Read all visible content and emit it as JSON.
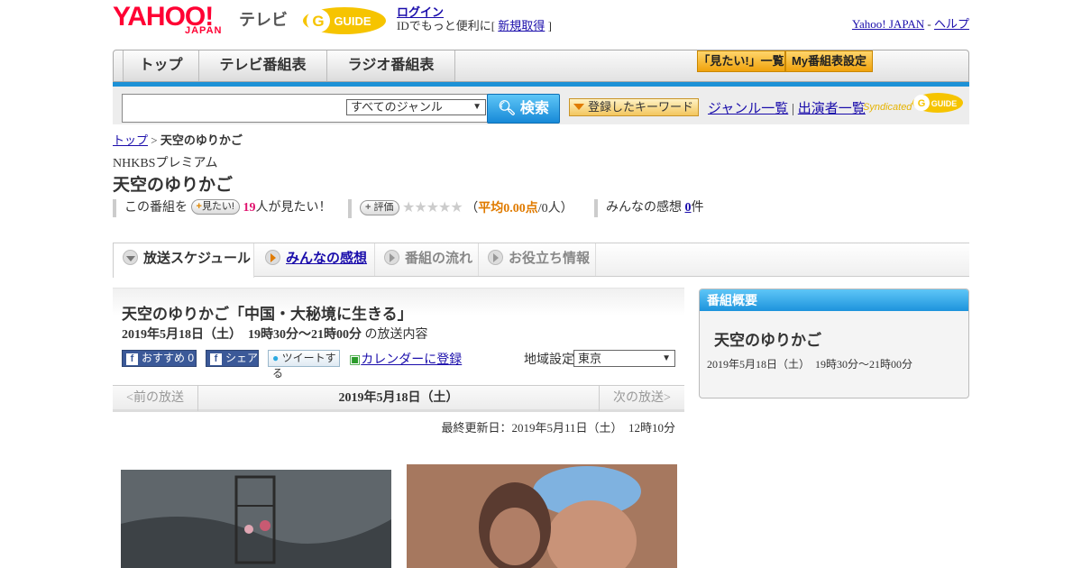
{
  "header": {
    "logo": "YAHOO!",
    "logo_sub": "JAPAN",
    "service": "テレビ",
    "gguide_logo": "GUIDE",
    "login_link": "ログイン",
    "login_text": "IDでもっと便利に[",
    "register_link": "新規取得",
    "login_close": "]",
    "yahoo_japan_link": "Yahoo! JAPAN",
    "sep": " - ",
    "help_link": "ヘルプ"
  },
  "nav": {
    "tabs": [
      "トップ",
      "テレビ番組表",
      "ラジオ番組表"
    ],
    "want_list": "「見たい!」一覧",
    "my_schedule": "My番組表設定"
  },
  "search": {
    "placeholder": "",
    "genre": "すべてのジャンル",
    "button": "検索",
    "keyword_button": "登録したキーワード",
    "genre_list": "ジャンル一覧",
    "divider": "|",
    "performer_list": "出演者一覧",
    "syndicated": "Syndicated"
  },
  "breadcrumb": {
    "top": "トップ",
    "sep": " > ",
    "current": "天空のゆりかご"
  },
  "program": {
    "channel": "NHKBSプレミアム",
    "title": "天空のゆりかご",
    "want_prefix": "この番組を",
    "want_button": "見たい!",
    "want_count": "19",
    "want_suffix": "人が見たい！",
    "rate_button": "評価",
    "stars": "★★★★★",
    "avg_open": "（",
    "avg_label": "平均0.00点",
    "avg_suffix": "/0人）",
    "impressions_prefix": "みんなの感想",
    "impressions_count": "0",
    "impressions_suffix": "件"
  },
  "tabs": [
    {
      "label": "放送スケジュール"
    },
    {
      "label": "みんなの感想"
    },
    {
      "label": "番組の流れ"
    },
    {
      "label": "お役立ち情報"
    }
  ],
  "episode": {
    "title": "天空のゆりかご「中国・大秘境に生きる」",
    "datetime": "2019年5月18日（土）　19時30分～21時00分",
    "datetime_suffix": " の放送内容",
    "recommend": "おすすめ 0",
    "share": "シェア",
    "tweet": "ツイートする",
    "calendar": "カレンダーに登録",
    "region_label": "地域設定",
    "region_value": "東京",
    "prev": "<前の放送",
    "current": "2019年5月18日（土）",
    "next": "次の放送>",
    "updated": "最終更新日：2019年5月11日（土）　12時10分"
  },
  "sidebar": {
    "header": "番組概要",
    "title": "天空のゆりかご",
    "time": "2019年5月18日（土）　19時30分～21時00分"
  },
  "colors": {
    "accent_blue": "#1d91d6",
    "orange": "#f0a20c",
    "brand_red": "#ff0033"
  }
}
